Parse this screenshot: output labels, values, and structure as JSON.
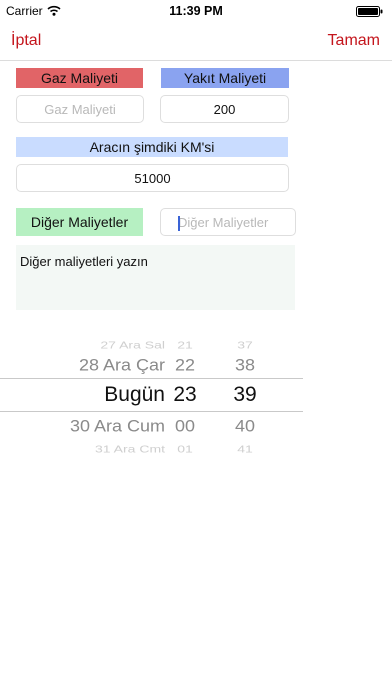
{
  "status_bar": {
    "carrier": "Carrier",
    "time": "11:39 PM"
  },
  "nav": {
    "cancel_label": "İptal",
    "done_label": "Tamam"
  },
  "gas": {
    "label": "Gaz Maliyeti",
    "placeholder": "Gaz Maliyeti",
    "value": ""
  },
  "fuel": {
    "label": "Yakıt Maliyeti",
    "value": "200"
  },
  "km": {
    "label": "Aracın şimdiki KM'si",
    "value": "51000"
  },
  "other": {
    "label": "Diğer Maliyetler",
    "placeholder": "Diğer Maliyetler"
  },
  "notes": {
    "text": "Diğer maliyetleri yazın"
  },
  "picker": {
    "rows": [
      {
        "date": "27 Ara Sal",
        "hour": "21",
        "minute": "37"
      },
      {
        "date": "28 Ara Çar",
        "hour": "22",
        "minute": "38"
      },
      {
        "date": "Bugün",
        "hour": "23",
        "minute": "39",
        "selected": true
      },
      {
        "date": "30 Ara Cum",
        "hour": "00",
        "minute": "40"
      },
      {
        "date": "31 Ara Cmt",
        "hour": "01",
        "minute": "41"
      }
    ]
  },
  "colors": {
    "accent": "#c4151c",
    "gas_label_bg": "#e16467",
    "fuel_label_bg": "#8aa3f0",
    "km_label_bg": "#c9dcff",
    "other_label_bg": "#b6f0c2"
  }
}
